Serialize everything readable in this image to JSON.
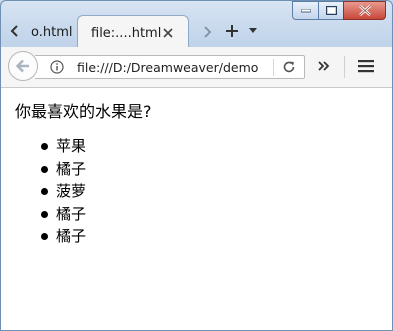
{
  "browser": {
    "tabs": [
      {
        "label": "o.html",
        "active": false
      },
      {
        "label": "file:....html",
        "active": true
      }
    ],
    "address": "file:///D:/Dreamweaver/demo"
  },
  "page": {
    "question": "你最喜欢的水果是?",
    "fruits": [
      "苹果",
      "橘子",
      "菠萝",
      "橘子",
      "橘子"
    ]
  },
  "colors": {
    "frame": "#b8cde6",
    "close_button": "#c8473a",
    "page_background": "#ffffff"
  },
  "icons": [
    "back-arrow-icon",
    "info-icon",
    "reload-icon",
    "overflow-icon",
    "hamburger-menu-icon",
    "close-icon",
    "plus-icon",
    "chevron-left-icon",
    "chevron-right-icon",
    "chevron-down-icon"
  ]
}
